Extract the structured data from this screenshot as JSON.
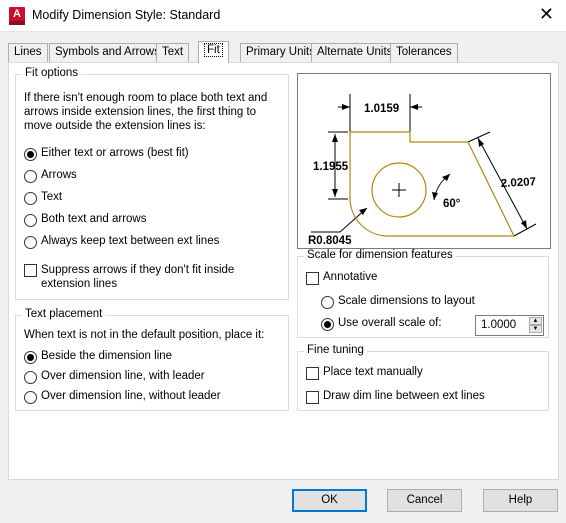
{
  "window": {
    "title": "Modify Dimension Style: Standard",
    "app_icon_letter": "A"
  },
  "tabs": [
    "Lines",
    "Symbols and Arrows",
    "Text",
    "Fit",
    "Primary Units",
    "Alternate Units",
    "Tolerances"
  ],
  "active_tab": "Fit",
  "fit_options": {
    "legend": "Fit options",
    "description": "If there isn't enough room to place both text and arrows inside extension lines, the first thing to move outside the extension lines is:",
    "options": [
      "Either text or arrows (best fit)",
      "Arrows",
      "Text",
      "Both text and arrows",
      "Always keep text between ext lines"
    ],
    "selected": "Either text or arrows (best fit)",
    "suppress_label": "Suppress arrows if they don't fit inside extension lines",
    "suppress_checked": false
  },
  "text_placement": {
    "legend": "Text placement",
    "description": "When text is not in the default position, place it:",
    "options": [
      "Beside the dimension line",
      "Over dimension line, with leader",
      "Over dimension line, without leader"
    ],
    "selected": "Beside the dimension line"
  },
  "preview": {
    "dim_top": "1.0159",
    "dim_left": "1.1955",
    "dim_right": "2.0207",
    "angle": "60°",
    "radius": "R0.8045",
    "shape_color": "#b8860b"
  },
  "scale": {
    "legend": "Scale for dimension features",
    "annotative_label": "Annotative",
    "annotative_checked": false,
    "layout_label": "Scale dimensions to layout",
    "overall_label": "Use overall scale of:",
    "selected": "Use overall scale of:",
    "overall_value": "1.0000"
  },
  "fine_tuning": {
    "legend": "Fine tuning",
    "manual_label": "Place text manually",
    "manual_checked": false,
    "draw_label": "Draw dim line between ext lines",
    "draw_checked": false
  },
  "buttons": {
    "ok": "OK",
    "cancel": "Cancel",
    "help": "Help"
  },
  "colors": {
    "focus_border": "#0078d7",
    "app_icon": "#c8102e"
  }
}
